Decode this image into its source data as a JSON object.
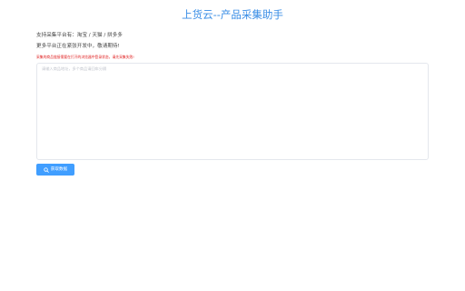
{
  "header": {
    "title": "上货云--产品采集助手"
  },
  "info": {
    "supported_platforms": "支持采集平台有：淘宝 / 天猫 / 拼多多",
    "more_platforms": "更多平台正在紧张开发中，敬请期待!"
  },
  "warning": {
    "text": "采集的商品链接需要在打开的浏览器中登录状态，请先采集失败!"
  },
  "url_input": {
    "placeholder": "请输入商品地址，多个商品请回车分隔",
    "value": ""
  },
  "actions": {
    "fetch_label": "获取数据"
  },
  "colors": {
    "accent": "#409eff",
    "title": "#3a8ee6",
    "warning": "#e02020"
  },
  "icons": {
    "fetch_icon": "search-icon"
  }
}
